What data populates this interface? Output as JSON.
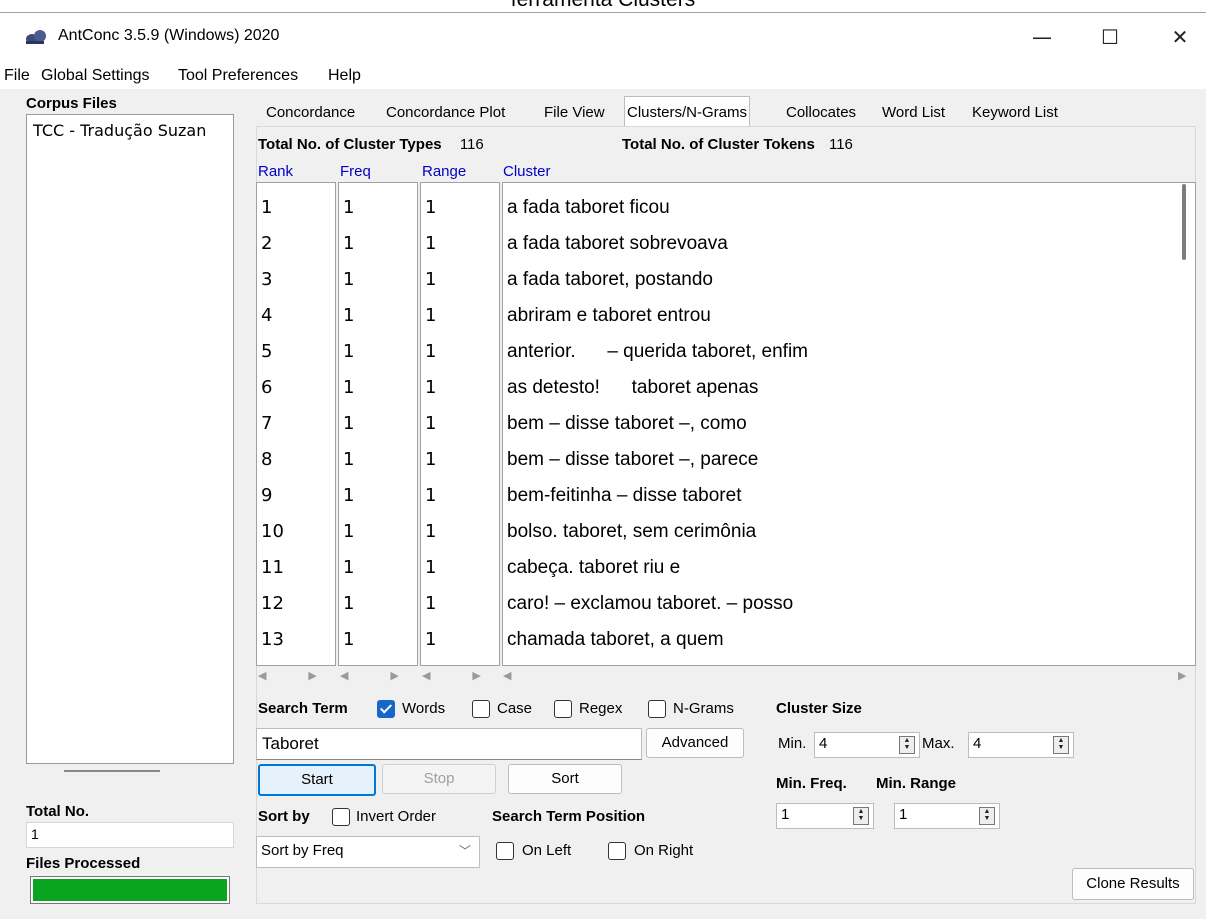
{
  "caption": "ferramenta Clusters",
  "window": {
    "title": "AntConc 3.5.9 (Windows) 2020",
    "minimize": "—",
    "maximize": "☐",
    "close": "✕"
  },
  "menu": [
    "File",
    "Global Settings",
    "Tool Preferences",
    "Help"
  ],
  "left_panel": {
    "corpus_files_label": "Corpus Files",
    "files": [
      "TCC - Tradução Suzan"
    ],
    "total_no_label": "Total No.",
    "total_no_value": "1",
    "files_processed_label": "Files Processed",
    "progress": 1.0
  },
  "tabs": [
    "Concordance",
    "Concordance Plot",
    "File View",
    "Clusters/N-Grams",
    "Collocates",
    "Word List",
    "Keyword List"
  ],
  "active_tab": "Clusters/N-Grams",
  "stats": {
    "types_label": "Total No. of Cluster Types",
    "types_value": "116",
    "tokens_label": "Total No. of Cluster Tokens",
    "tokens_value": "116"
  },
  "columns": {
    "rank": "Rank",
    "freq": "Freq",
    "range": "Range",
    "cluster": "Cluster"
  },
  "rows": [
    {
      "rank": "1",
      "freq": "1",
      "range": "1",
      "cluster": "a fada taboret ficou"
    },
    {
      "rank": "2",
      "freq": "1",
      "range": "1",
      "cluster": "a fada taboret sobrevoava"
    },
    {
      "rank": "3",
      "freq": "1",
      "range": "1",
      "cluster": "a fada taboret, postando"
    },
    {
      "rank": "4",
      "freq": "1",
      "range": "1",
      "cluster": "abriram e taboret entrou"
    },
    {
      "rank": "5",
      "freq": "1",
      "range": "1",
      "cluster": "anterior.      – querida taboret, enfim"
    },
    {
      "rank": "6",
      "freq": "1",
      "range": "1",
      "cluster": "as detesto!      taboret apenas"
    },
    {
      "rank": "7",
      "freq": "1",
      "range": "1",
      "cluster": "bem – disse taboret –, como"
    },
    {
      "rank": "8",
      "freq": "1",
      "range": "1",
      "cluster": "bem – disse taboret –, parece"
    },
    {
      "rank": "9",
      "freq": "1",
      "range": "1",
      "cluster": "bem-feitinha – disse taboret"
    },
    {
      "rank": "10",
      "freq": "1",
      "range": "1",
      "cluster": "bolso. taboret, sem cerimônia"
    },
    {
      "rank": "11",
      "freq": "1",
      "range": "1",
      "cluster": "cabeça. taboret riu e"
    },
    {
      "rank": "12",
      "freq": "1",
      "range": "1",
      "cluster": "caro! – exclamou taboret. – posso"
    },
    {
      "rank": "13",
      "freq": "1",
      "range": "1",
      "cluster": "chamada taboret, a quem"
    }
  ],
  "search": {
    "label": "Search Term",
    "words_label": "Words",
    "words_checked": true,
    "case_label": "Case",
    "case_checked": false,
    "regex_label": "Regex",
    "regex_checked": false,
    "ngrams_label": "N-Grams",
    "ngrams_checked": false,
    "value": "Taboret",
    "advanced_label": "Advanced"
  },
  "buttons": {
    "start": "Start",
    "stop": "Stop",
    "sort": "Sort",
    "clone": "Clone Results"
  },
  "sort": {
    "label": "Sort by",
    "invert_label": "Invert Order",
    "invert_checked": false,
    "selected": "Sort by Freq"
  },
  "position": {
    "label": "Search Term Position",
    "left_label": "On Left",
    "left_checked": false,
    "right_label": "On Right",
    "right_checked": false
  },
  "cluster_size": {
    "label": "Cluster Size",
    "min_label": "Min.",
    "min_value": "4",
    "max_label": "Max.",
    "max_value": "4"
  },
  "min_freq": {
    "label": "Min. Freq.",
    "value": "1"
  },
  "min_range": {
    "label": "Min. Range",
    "value": "1"
  }
}
